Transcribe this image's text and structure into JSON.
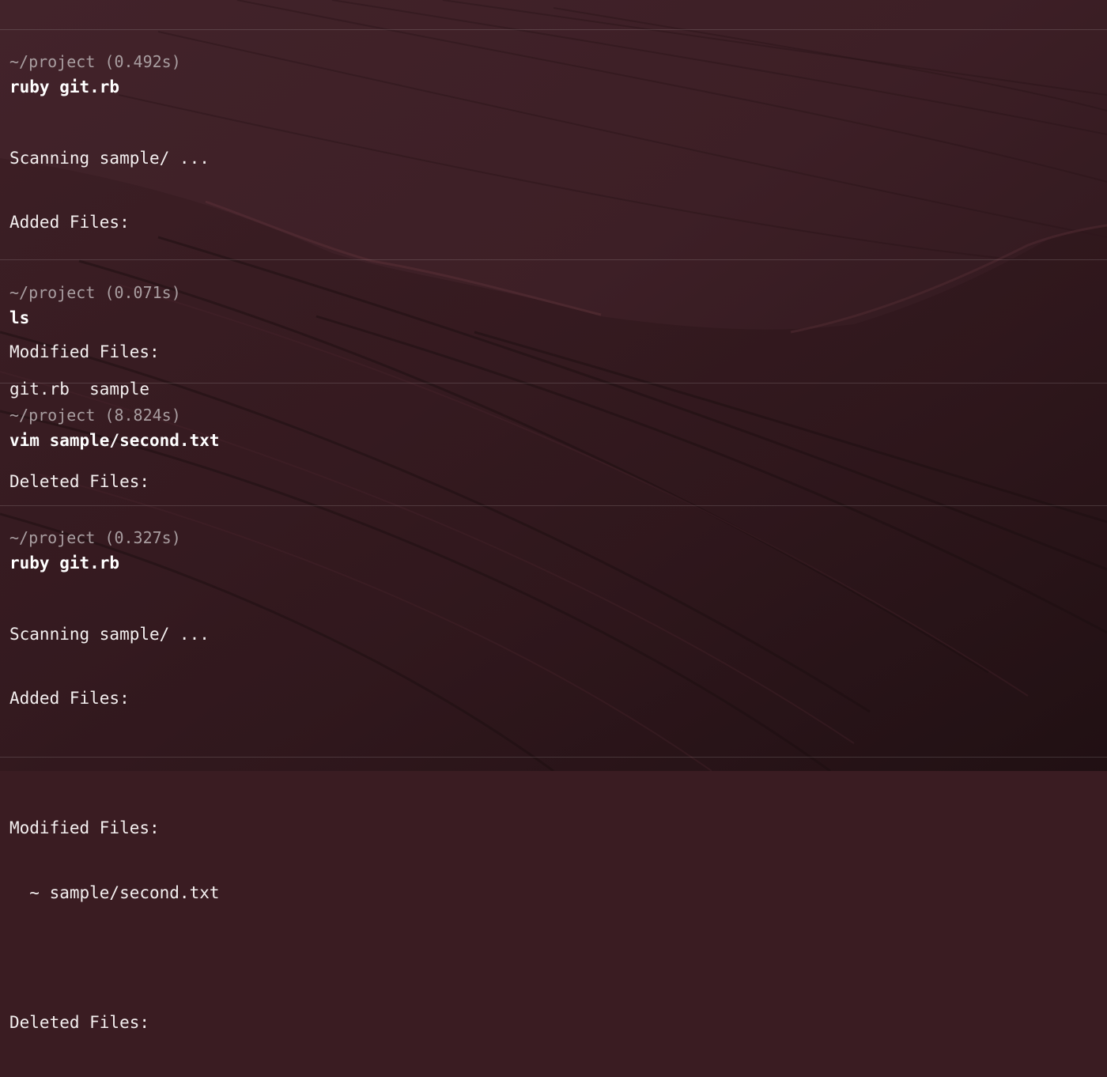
{
  "blocks": [
    {
      "prompt": "~/project (0.492s)",
      "command": "ruby git.rb",
      "output": [
        "Scanning sample/ ...",
        "Added Files:",
        "",
        "Modified Files:",
        "",
        "Deleted Files:"
      ]
    },
    {
      "prompt": "~/project (0.071s)",
      "command": "ls",
      "output": [
        "git.rb  sample"
      ]
    },
    {
      "prompt": "~/project (8.824s)",
      "command": "vim sample/second.txt",
      "output": []
    },
    {
      "prompt": "~/project (0.327s)",
      "command": "ruby git.rb",
      "output": [
        "Scanning sample/ ...",
        "Added Files:",
        "",
        "Modified Files:",
        "  ~ sample/second.txt",
        "",
        "Deleted Files:"
      ]
    }
  ],
  "colors": {
    "background": "#3a1c22",
    "prompt": "#a99ea1",
    "command": "#ffffff",
    "output": "#f4f0f0"
  }
}
